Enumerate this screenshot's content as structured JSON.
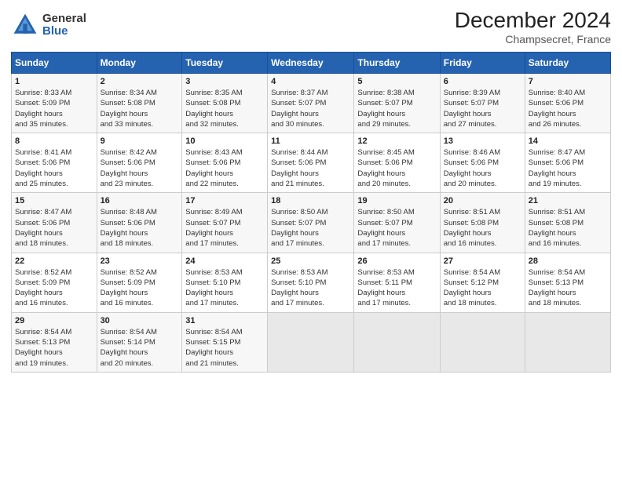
{
  "logo": {
    "general": "General",
    "blue": "Blue"
  },
  "title": "December 2024",
  "subtitle": "Champsecret, France",
  "weekdays": [
    "Sunday",
    "Monday",
    "Tuesday",
    "Wednesday",
    "Thursday",
    "Friday",
    "Saturday"
  ],
  "weeks": [
    [
      {
        "day": "1",
        "sunrise": "8:33 AM",
        "sunset": "5:09 PM",
        "daylight": "8 hours and 35 minutes."
      },
      {
        "day": "2",
        "sunrise": "8:34 AM",
        "sunset": "5:08 PM",
        "daylight": "8 hours and 33 minutes."
      },
      {
        "day": "3",
        "sunrise": "8:35 AM",
        "sunset": "5:08 PM",
        "daylight": "8 hours and 32 minutes."
      },
      {
        "day": "4",
        "sunrise": "8:37 AM",
        "sunset": "5:07 PM",
        "daylight": "8 hours and 30 minutes."
      },
      {
        "day": "5",
        "sunrise": "8:38 AM",
        "sunset": "5:07 PM",
        "daylight": "8 hours and 29 minutes."
      },
      {
        "day": "6",
        "sunrise": "8:39 AM",
        "sunset": "5:07 PM",
        "daylight": "8 hours and 27 minutes."
      },
      {
        "day": "7",
        "sunrise": "8:40 AM",
        "sunset": "5:06 PM",
        "daylight": "8 hours and 26 minutes."
      }
    ],
    [
      {
        "day": "8",
        "sunrise": "8:41 AM",
        "sunset": "5:06 PM",
        "daylight": "8 hours and 25 minutes."
      },
      {
        "day": "9",
        "sunrise": "8:42 AM",
        "sunset": "5:06 PM",
        "daylight": "8 hours and 23 minutes."
      },
      {
        "day": "10",
        "sunrise": "8:43 AM",
        "sunset": "5:06 PM",
        "daylight": "8 hours and 22 minutes."
      },
      {
        "day": "11",
        "sunrise": "8:44 AM",
        "sunset": "5:06 PM",
        "daylight": "8 hours and 21 minutes."
      },
      {
        "day": "12",
        "sunrise": "8:45 AM",
        "sunset": "5:06 PM",
        "daylight": "8 hours and 20 minutes."
      },
      {
        "day": "13",
        "sunrise": "8:46 AM",
        "sunset": "5:06 PM",
        "daylight": "8 hours and 20 minutes."
      },
      {
        "day": "14",
        "sunrise": "8:47 AM",
        "sunset": "5:06 PM",
        "daylight": "8 hours and 19 minutes."
      }
    ],
    [
      {
        "day": "15",
        "sunrise": "8:47 AM",
        "sunset": "5:06 PM",
        "daylight": "8 hours and 18 minutes."
      },
      {
        "day": "16",
        "sunrise": "8:48 AM",
        "sunset": "5:06 PM",
        "daylight": "8 hours and 18 minutes."
      },
      {
        "day": "17",
        "sunrise": "8:49 AM",
        "sunset": "5:07 PM",
        "daylight": "8 hours and 17 minutes."
      },
      {
        "day": "18",
        "sunrise": "8:50 AM",
        "sunset": "5:07 PM",
        "daylight": "8 hours and 17 minutes."
      },
      {
        "day": "19",
        "sunrise": "8:50 AM",
        "sunset": "5:07 PM",
        "daylight": "8 hours and 17 minutes."
      },
      {
        "day": "20",
        "sunrise": "8:51 AM",
        "sunset": "5:08 PM",
        "daylight": "8 hours and 16 minutes."
      },
      {
        "day": "21",
        "sunrise": "8:51 AM",
        "sunset": "5:08 PM",
        "daylight": "8 hours and 16 minutes."
      }
    ],
    [
      {
        "day": "22",
        "sunrise": "8:52 AM",
        "sunset": "5:09 PM",
        "daylight": "8 hours and 16 minutes."
      },
      {
        "day": "23",
        "sunrise": "8:52 AM",
        "sunset": "5:09 PM",
        "daylight": "8 hours and 16 minutes."
      },
      {
        "day": "24",
        "sunrise": "8:53 AM",
        "sunset": "5:10 PM",
        "daylight": "8 hours and 17 minutes."
      },
      {
        "day": "25",
        "sunrise": "8:53 AM",
        "sunset": "5:10 PM",
        "daylight": "8 hours and 17 minutes."
      },
      {
        "day": "26",
        "sunrise": "8:53 AM",
        "sunset": "5:11 PM",
        "daylight": "8 hours and 17 minutes."
      },
      {
        "day": "27",
        "sunrise": "8:54 AM",
        "sunset": "5:12 PM",
        "daylight": "8 hours and 18 minutes."
      },
      {
        "day": "28",
        "sunrise": "8:54 AM",
        "sunset": "5:13 PM",
        "daylight": "8 hours and 18 minutes."
      }
    ],
    [
      {
        "day": "29",
        "sunrise": "8:54 AM",
        "sunset": "5:13 PM",
        "daylight": "8 hours and 19 minutes."
      },
      {
        "day": "30",
        "sunrise": "8:54 AM",
        "sunset": "5:14 PM",
        "daylight": "8 hours and 20 minutes."
      },
      {
        "day": "31",
        "sunrise": "8:54 AM",
        "sunset": "5:15 PM",
        "daylight": "8 hours and 21 minutes."
      },
      null,
      null,
      null,
      null
    ]
  ],
  "labels": {
    "sunrise": "Sunrise:",
    "sunset": "Sunset:",
    "daylight": "Daylight hours"
  }
}
